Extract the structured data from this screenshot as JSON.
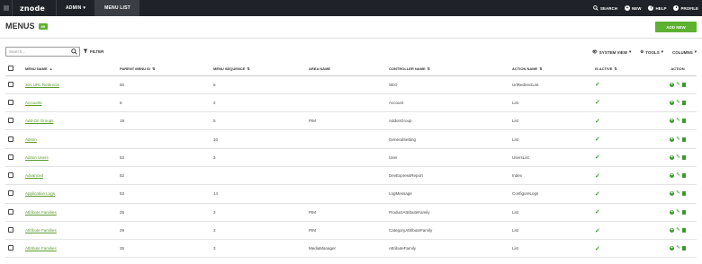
{
  "topbar": {
    "logo": "znode",
    "admin_label": "ADMIN",
    "menu_list_label": "MENU LIST",
    "search_label": "SEARCH",
    "new_label": "NEW",
    "help_label": "HELP",
    "profile_label": "PROFILE"
  },
  "header": {
    "title": "MENUS",
    "count_badge": "89",
    "add_new_label": "ADD NEW"
  },
  "toolbar": {
    "search_placeholder": "Search...",
    "filter_label": "FILTER",
    "system_view_label": "SYSTEM VIEW",
    "tools_label": "TOOLS",
    "columns_label": "COLUMNS"
  },
  "table": {
    "headers": {
      "menu_name": "MENU NAME",
      "parent_menu_id": "PARENT MENU ID",
      "menu_sequence": "MENU SEQUENCE",
      "area_name": "AREA NAME",
      "controller_name": "CONTROLLER NAME",
      "action_name": "ACTION NAME",
      "is_active": "IS ACTIVE",
      "action": "ACTION"
    },
    "rows": [
      {
        "menu_name": "301 URL Redirects",
        "parent_menu_id": "50",
        "menu_sequence": "5",
        "area_name": "",
        "controller_name": "SEO",
        "action_name": "UrlRedirectList",
        "is_active": "✓"
      },
      {
        "menu_name": "Accounts",
        "parent_menu_id": "5",
        "menu_sequence": "2",
        "area_name": "",
        "controller_name": "Account",
        "action_name": "List",
        "is_active": "✓"
      },
      {
        "menu_name": "Add-On Groups",
        "parent_menu_id": "19",
        "menu_sequence": "5",
        "area_name": "PIM",
        "controller_name": "AddonGroup",
        "action_name": "List",
        "is_active": "✓"
      },
      {
        "menu_name": "Admin",
        "parent_menu_id": "",
        "menu_sequence": "10",
        "area_name": "",
        "controller_name": "GeneralSetting",
        "action_name": "List",
        "is_active": "✓"
      },
      {
        "menu_name": "Admin Users",
        "parent_menu_id": "53",
        "menu_sequence": "3",
        "area_name": "",
        "controller_name": "User",
        "action_name": "UsersList",
        "is_active": "✓"
      },
      {
        "menu_name": "Advanced",
        "parent_menu_id": "52",
        "menu_sequence": "",
        "area_name": "",
        "controller_name": "DevExpressReport",
        "action_name": "Index",
        "is_active": "✓"
      },
      {
        "menu_name": "Application Logs",
        "parent_menu_id": "53",
        "menu_sequence": "14",
        "area_name": "",
        "controller_name": "LogMessage",
        "action_name": "ConfigureLogs",
        "is_active": "✓"
      },
      {
        "menu_name": "Attribute Families",
        "parent_menu_id": "25",
        "menu_sequence": "3",
        "area_name": "PIM",
        "controller_name": "ProductAttributeFamily",
        "action_name": "List",
        "is_active": "✓"
      },
      {
        "menu_name": "Attribute Families",
        "parent_menu_id": "29",
        "menu_sequence": "3",
        "area_name": "PIM",
        "controller_name": "CategoryAttributeFamily",
        "action_name": "List",
        "is_active": "✓"
      },
      {
        "menu_name": "Attribute Families",
        "parent_menu_id": "35",
        "menu_sequence": "3",
        "area_name": "MediaManager",
        "controller_name": "AttributeFamily",
        "action_name": "List",
        "is_active": "✓"
      }
    ]
  },
  "colors": {
    "topbar_bg": "#1f2228",
    "accent_green": "#5db130",
    "link_green": "#5a9a2f"
  }
}
